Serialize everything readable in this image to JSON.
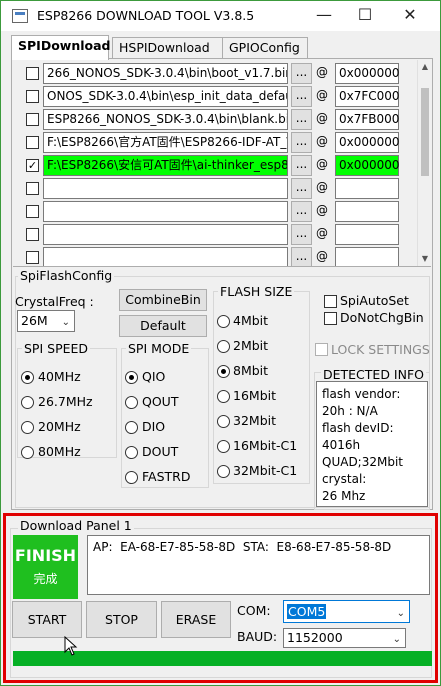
{
  "window": {
    "title": "ESP8266 DOWNLOAD TOOL V3.8.5",
    "minimize_glyph": "—",
    "maximize_glyph": "☐",
    "close_glyph": "✕"
  },
  "tabs": [
    "SPIDownload",
    "HSPIDownload",
    "GPIOConfig"
  ],
  "files": [
    {
      "checked": false,
      "path": "266_NONOS_SDK-3.0.4\\bin\\boot_v1.7.bin",
      "browse": "...",
      "at": "@",
      "address": "0x000000",
      "highlight": false
    },
    {
      "checked": false,
      "path": "ONOS_SDK-3.0.4\\bin\\esp_init_data_defau",
      "browse": "...",
      "at": "@",
      "address": "0x7FC000",
      "highlight": false
    },
    {
      "checked": false,
      "path": "ESP8266_NONOS_SDK-3.0.4\\bin\\blank.bir",
      "browse": "...",
      "at": "@",
      "address": "0x7FB000",
      "highlight": false
    },
    {
      "checked": false,
      "path": "F:\\ESP8266\\官方AT固件\\ESP8266-IDF-AT_\\",
      "browse": "...",
      "at": "@",
      "address": "0x000000",
      "highlight": false
    },
    {
      "checked": true,
      "path": "F:\\ESP8266\\安信可AT固件\\ai-thinker_esp82",
      "browse": "...",
      "at": "@",
      "address": "0x000000",
      "highlight": true
    },
    {
      "checked": false,
      "path": "",
      "browse": "...",
      "at": "@",
      "address": "",
      "highlight": false
    },
    {
      "checked": false,
      "path": "",
      "browse": "...",
      "at": "@",
      "address": "",
      "highlight": false
    },
    {
      "checked": false,
      "path": "",
      "browse": "...",
      "at": "@",
      "address": "",
      "highlight": false
    },
    {
      "checked": false,
      "path": "",
      "browse": "...",
      "at": "@",
      "address": "",
      "highlight": false
    }
  ],
  "spiflash": {
    "title": "SpiFlashConfig",
    "crystal_label": "CrystalFreq :",
    "crystal_value": "26M",
    "combine_label": "CombineBin",
    "default_label": "Default",
    "speed_title": "SPI SPEED",
    "speeds": [
      "40MHz",
      "26.7MHz",
      "20MHz",
      "80MHz"
    ],
    "speed_selected": 0,
    "mode_title": "SPI MODE",
    "modes": [
      "QIO",
      "QOUT",
      "DIO",
      "DOUT",
      "FASTRD"
    ],
    "mode_selected": 0,
    "size_title": "FLASH SIZE",
    "sizes": [
      "4Mbit",
      "2Mbit",
      "8Mbit",
      "16Mbit",
      "32Mbit",
      "16Mbit-C1",
      "32Mbit-C1"
    ],
    "size_selected": 2,
    "spi_auto_set": "SpiAutoSet",
    "do_not_chg_bin": "DoNotChgBin",
    "lock_settings": "LOCK SETTINGS",
    "detected_title": "DETECTED INFO",
    "detected_lines": [
      "flash vendor:",
      "20h : N/A",
      "flash devID:",
      "4016h",
      "QUAD;32Mbit",
      "crystal:",
      "26 Mhz"
    ]
  },
  "download": {
    "title": "Download Panel 1",
    "status_big": "FINISH",
    "status_small": "完成",
    "mac_text": "AP:  EA-68-E7-85-58-8D  STA:  E8-68-E7-85-58-8D",
    "start_label": "START",
    "stop_label": "STOP",
    "erase_label": "ERASE",
    "com_label": "COM:",
    "com_value": "COM5",
    "baud_label": "BAUD:",
    "baud_value": "1152000",
    "progress": 1.0
  },
  "colors": {
    "highlight_green": "#00ff00",
    "finish_green": "#1fbf1f",
    "progress_green": "#06b025",
    "panel_border_red": "#e00000",
    "selection_blue": "#0078d7"
  }
}
